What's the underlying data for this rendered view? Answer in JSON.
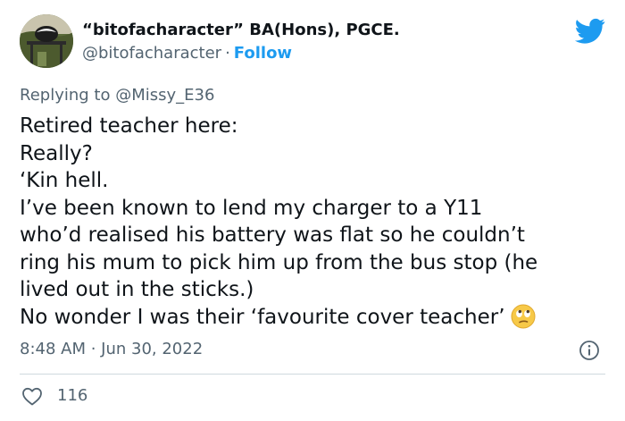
{
  "author": {
    "display_name": "“bitofacharacter” BA(Hons), PGCE.",
    "handle": "@bitofacharacter",
    "separator": "·",
    "follow_label": "Follow"
  },
  "reply": {
    "prefix": "Replying to",
    "mention": "@Missy_E36"
  },
  "body_lines": [
    "Retired teacher here:",
    "Really?",
    "‘Kin hell.",
    "I’ve been known to lend my charger to a Y11",
    "who’d realised his battery was flat so he couldn’t",
    "ring his mum to pick him up from the bus stop (he",
    "lived out in the sticks.)",
    "No wonder I was their ‘favourite cover teacher’"
  ],
  "timestamp": "8:48 AM · Jun 30, 2022",
  "likes": {
    "count": "116"
  },
  "icons": {
    "brand": "twitter-bird-icon",
    "emoji": "face-with-rolling-eyes-icon",
    "info": "info-icon",
    "like": "heart-outline-icon"
  },
  "colors": {
    "brand": "#1d9bf0",
    "text": "#0f1419",
    "secondary": "#536471",
    "divider": "#cfd9de"
  }
}
